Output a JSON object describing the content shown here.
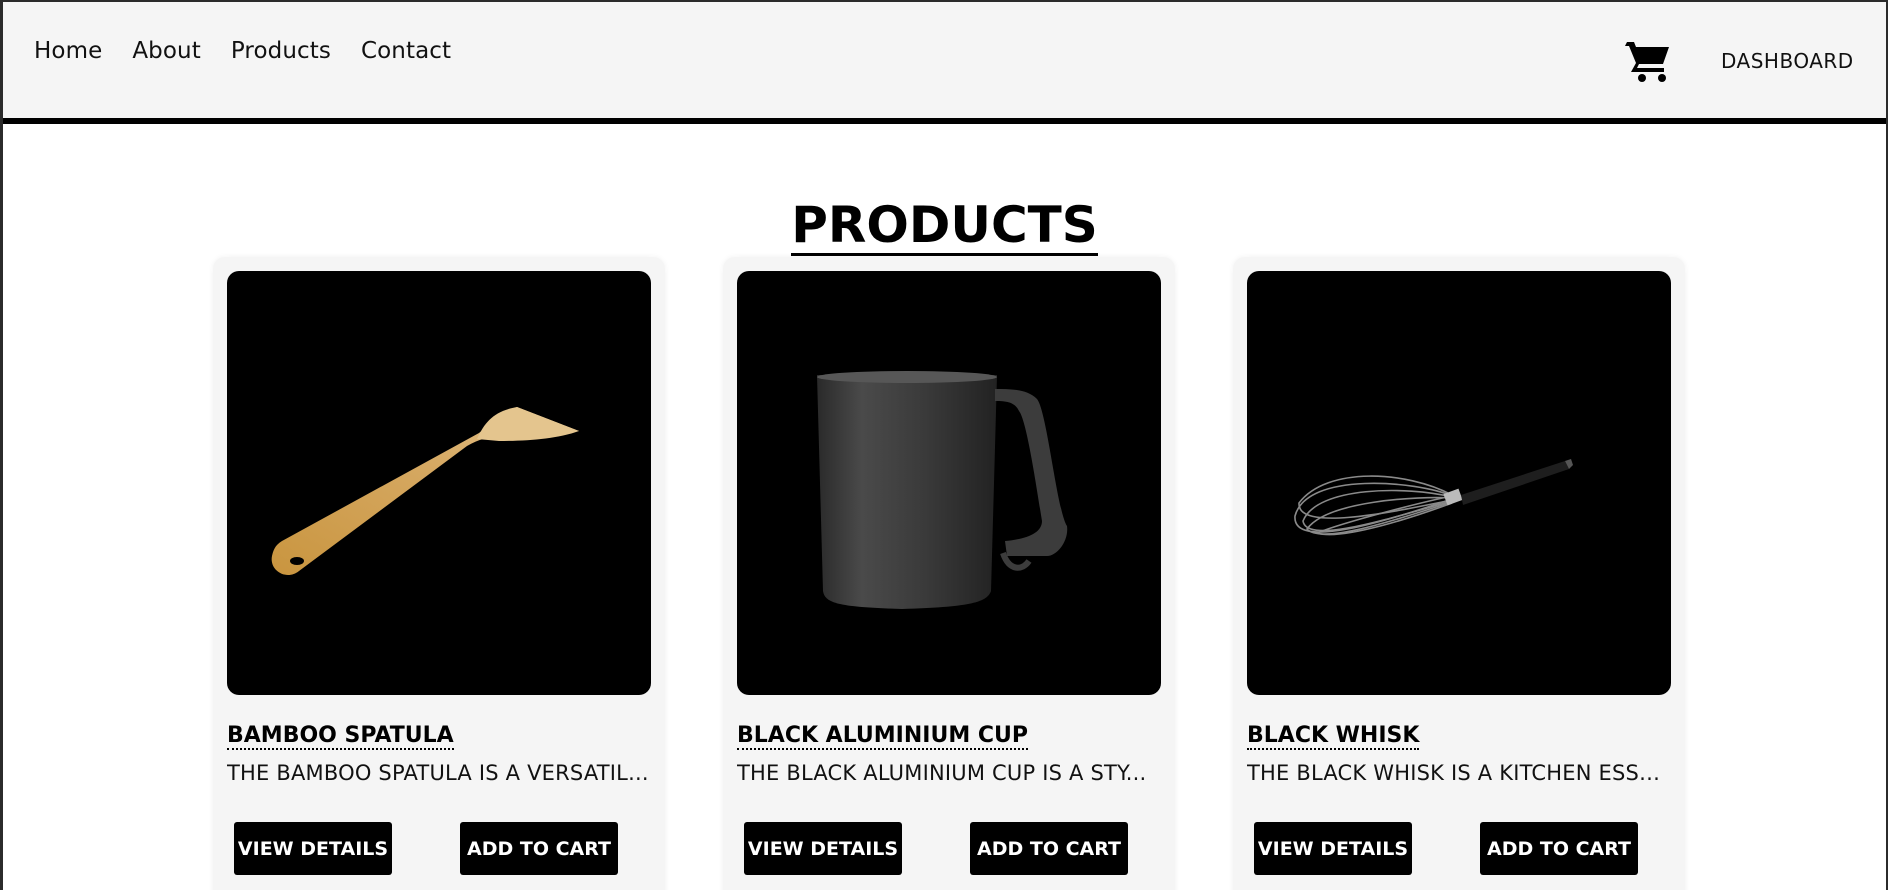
{
  "nav": {
    "links": [
      "Home",
      "About",
      "Products",
      "Contact"
    ],
    "cart_icon": "shopping-cart-icon",
    "dashboard_label": "DASHBOARD"
  },
  "page": {
    "title": "PRODUCTS"
  },
  "products": [
    {
      "name": "BAMBOO SPATULA",
      "description": "THE BAMBOO SPATULA IS A VERSATIL...",
      "image": "bamboo-spatula-image",
      "view_label": "VIEW DETAILS",
      "cart_label": "ADD TO CART"
    },
    {
      "name": "BLACK ALUMINIUM CUP",
      "description": "THE BLACK ALUMINIUM CUP IS A STY...",
      "image": "black-cup-image",
      "view_label": "VIEW DETAILS",
      "cart_label": "ADD TO CART"
    },
    {
      "name": "BLACK WHISK",
      "description": "THE BLACK WHISK IS A KITCHEN ESSE...",
      "image": "black-whisk-image",
      "view_label": "VIEW DETAILS",
      "cart_label": "ADD TO CART"
    }
  ],
  "colors": {
    "navbar_bg": "#f5f5f5",
    "card_bg": "#f5f5f5",
    "button_bg": "#000000",
    "button_text": "#ffffff"
  }
}
